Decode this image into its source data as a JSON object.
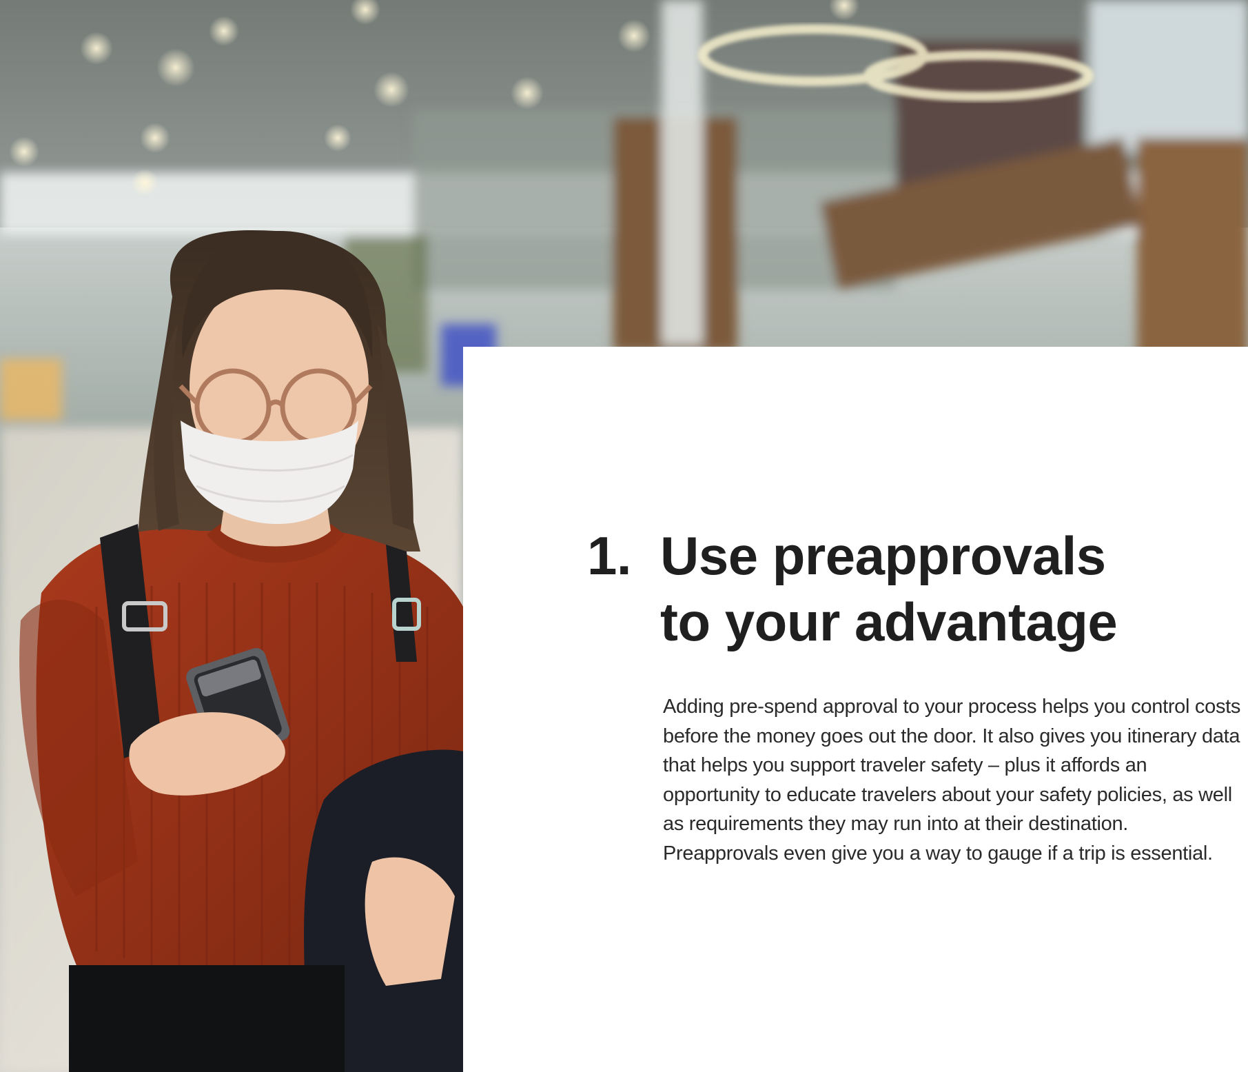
{
  "section": {
    "number": "1.",
    "heading_line_1": "Use preapprovals",
    "heading_line_2": "to your advantage",
    "body": "Adding pre-spend approval to your process helps you control costs before the money goes out the door. It also gives you itinerary data that helps you support traveler safety – plus it affords an opportunity to educate travelers about your safety policies, as well as requirements they may run into at their destination. Preapprovals even give you a way to gauge if a trip is essential."
  },
  "colors": {
    "heading": "#1f1f1f",
    "body": "#2a2a2a",
    "panel": "#ffffff",
    "sweater": "#9a3218",
    "mask": "#f1eeee"
  }
}
